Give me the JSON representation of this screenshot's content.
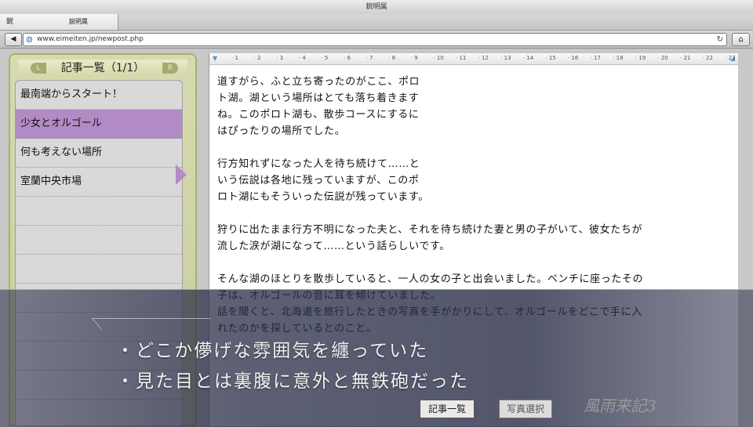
{
  "window": {
    "title": "鋭明属"
  },
  "tab": {
    "icon": "鋭",
    "title": "鋭明属"
  },
  "address": {
    "url": "www.eimeiten.jp/newpost.php"
  },
  "sidebar": {
    "header": "記事一覧（1/1）",
    "nav_left": "L",
    "nav_right": "R",
    "items": [
      {
        "label": "最南端からスタート！"
      },
      {
        "label": "少女とオルゴール"
      },
      {
        "label": "何も考えない場所"
      },
      {
        "label": "室蘭中央市場"
      }
    ],
    "active_index": 1,
    "accent_color": "#b28bc4"
  },
  "ruler": {
    "marks": [
      "1",
      "2",
      "3",
      "4",
      "5",
      "6",
      "7",
      "8",
      "9",
      "10",
      "11",
      "12",
      "13",
      "14",
      "15",
      "16",
      "17",
      "18",
      "19",
      "20",
      "21",
      "22",
      "23"
    ]
  },
  "article": {
    "paragraphs": [
      "道すがら、ふと立ち寄ったのがここ、ポロ\nト湖。湖という場所はとても落ち着きます\nね。このポロト湖も、散歩コースにするに\nはぴったりの場所でした。",
      "行方知れずになった人を待ち続けて……と\nいう伝説は各地に残っていますが、このポ\nロト湖にもそういった伝説が残っています。",
      "狩りに出たまま行方不明になった夫と、それを待ち続けた妻と男の子がいて、彼女たちが\n流した涙が湖になって……という話らしいです。",
      "そんな湖のほとりを散歩していると、一人の女の子と出会いました。ベンチに座ったその\n子は、オルゴールの音に耳を傾けていました。\n話を聞くと、北海道を旅行したときの写真を手がかりにして、オルゴールをどこで手に入\nれたのかを探しているとのこと。"
    ]
  },
  "buttons": {
    "list": "記事一覧",
    "photo": "写真選択"
  },
  "logo": "風雨来記3",
  "dialog": {
    "choices": [
      "・どこか儚げな雰囲気を纏っていた",
      "・見た目とは裏腹に意外と無鉄砲だった"
    ]
  }
}
